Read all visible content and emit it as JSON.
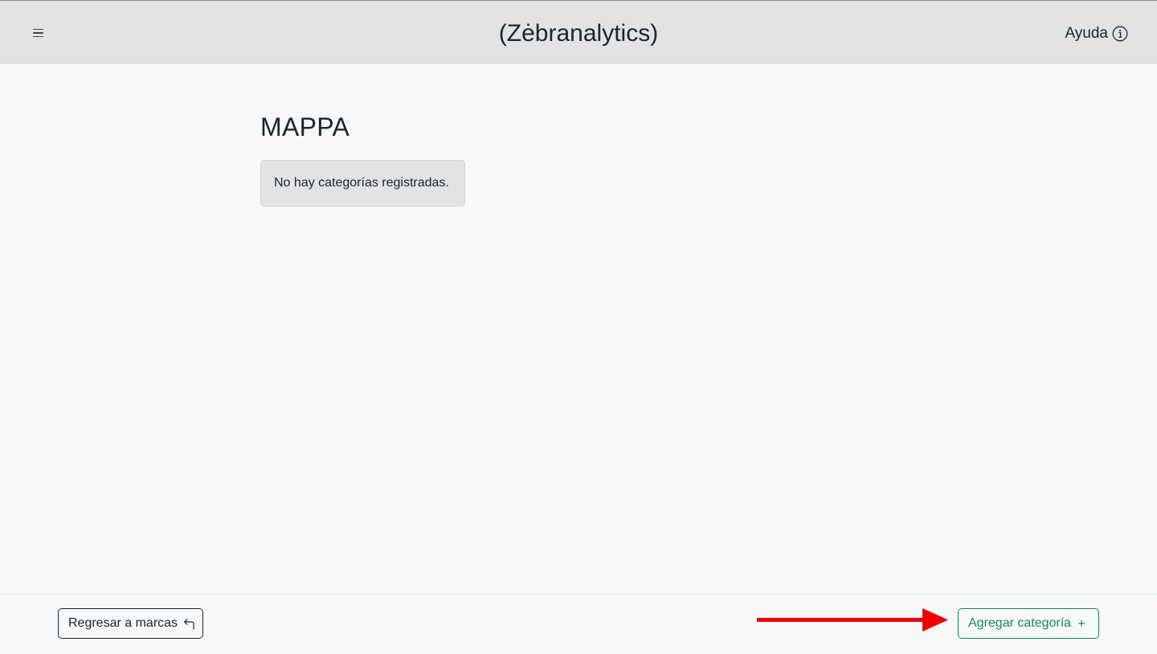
{
  "navbar": {
    "menu_icon": "hamburger-menu-icon",
    "brand": "(Zėbranalytics)",
    "help_label": "Ayuda",
    "help_icon": "info-circle-icon"
  },
  "main": {
    "title": "MAPPA",
    "empty_message": "No hay categorías registradas."
  },
  "footer": {
    "back_label": "Regresar a marcas",
    "back_icon": "return-arrow-icon",
    "add_label": "Agregar categoría",
    "add_icon": "plus-icon"
  },
  "annotation": {
    "arrow_icon": "red-arrow-icon",
    "arrow_color": "#ee0000"
  },
  "colors": {
    "navbar_bg": "#e2e3e5",
    "page_bg": "#f7f8fa",
    "success": "#198754"
  }
}
